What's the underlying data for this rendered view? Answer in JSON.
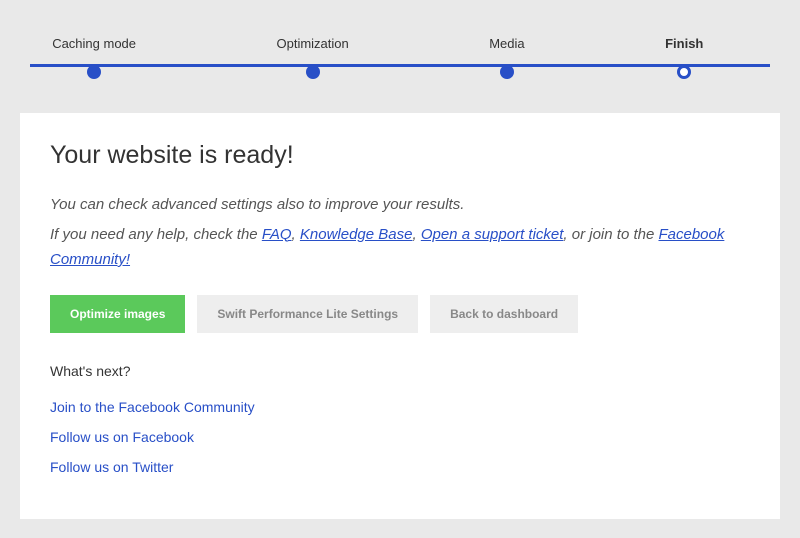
{
  "stepper": {
    "steps": [
      {
        "label": "Caching mode",
        "state": "done"
      },
      {
        "label": "Optimization",
        "state": "done"
      },
      {
        "label": "Media",
        "state": "done"
      },
      {
        "label": "Finish",
        "state": "current"
      }
    ]
  },
  "card": {
    "title": "Your website is ready!",
    "lead1": "You can check advanced settings also to improve your results.",
    "lead2_prefix": "If you need any help, check the ",
    "link_faq": "FAQ",
    "sep1": ", ",
    "link_kb": "Knowledge Base",
    "sep2": ", ",
    "link_ticket": "Open a support ticket",
    "sep3": ", or join to the ",
    "link_fb_comm": "Facebook Community!",
    "buttons": {
      "optimize": "Optimize images",
      "settings": "Swift Performance Lite Settings",
      "dashboard": "Back to dashboard"
    },
    "whats_next": "What's next?",
    "next_links": {
      "join_fb": "Join to the Facebook Community",
      "follow_fb": "Follow us on Facebook",
      "follow_tw": "Follow us on Twitter"
    }
  }
}
